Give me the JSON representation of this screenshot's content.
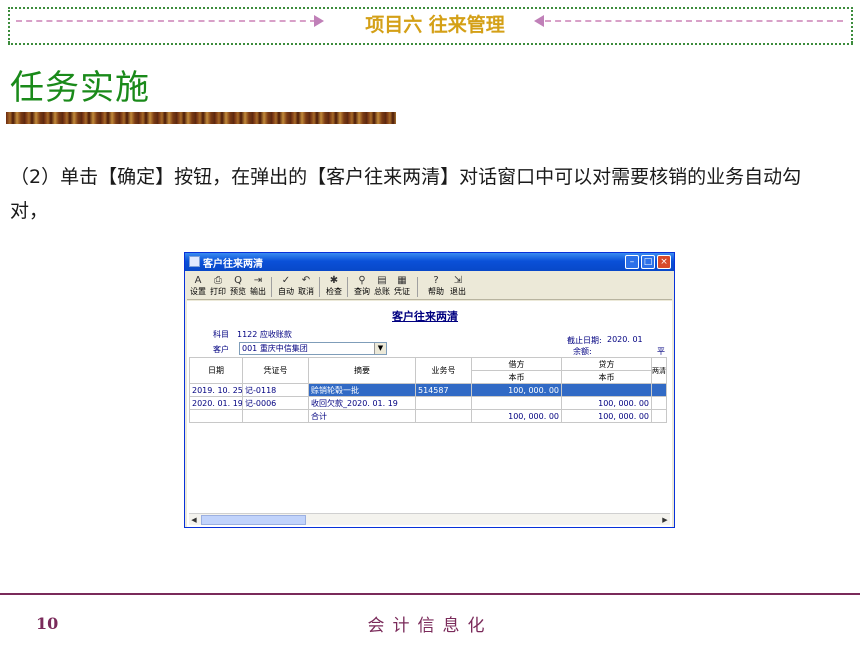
{
  "header": {
    "title": "项目六 往来管理"
  },
  "task_title": "任务实施",
  "paragraph": "（2）单击【确定】按钮，在弹出的【客户往来两清】对话窗口中可以对需要核销的业务自动勾对，",
  "window": {
    "title": "客户往来两清",
    "toolbar": [
      {
        "label": "设置",
        "icon": "settings-icon",
        "glyph": "A"
      },
      {
        "label": "打印",
        "icon": "print-icon",
        "glyph": "⎙"
      },
      {
        "label": "预览",
        "icon": "preview-icon",
        "glyph": "Q"
      },
      {
        "label": "输出",
        "icon": "export-icon",
        "glyph": "⇥"
      },
      {
        "label": "自动",
        "icon": "auto-icon",
        "glyph": "✓"
      },
      {
        "label": "取消",
        "icon": "undo-icon",
        "glyph": "↶"
      },
      {
        "label": "检查",
        "icon": "check-icon",
        "glyph": "✱"
      },
      {
        "label": "查询",
        "icon": "binoculars-icon",
        "glyph": "⚲"
      },
      {
        "label": "总账",
        "icon": "ledger-icon",
        "glyph": "▤"
      },
      {
        "label": "凭证",
        "icon": "voucher-icon",
        "glyph": "▦"
      },
      {
        "label": "帮助",
        "icon": "help-icon",
        "glyph": "?"
      },
      {
        "label": "退出",
        "icon": "exit-icon",
        "glyph": "⇲"
      }
    ],
    "doc_title": "客户往来两清",
    "subject_label": "科目",
    "subject_value": "1122 应收账款",
    "customer_label": "客户",
    "customer_value": "001  重庆中信集团",
    "cutoff_label": "截止日期:",
    "cutoff_value": "2020. 01",
    "balance_label": "余额:",
    "balance_value": "平",
    "columns": {
      "date": "日期",
      "voucher": "凭证号",
      "summary": "摘要",
      "biz_no": "业务号",
      "debit": "借方",
      "credit": "贷方",
      "debit_sub": "本币",
      "credit_sub": "本币",
      "clear": "两清"
    },
    "rows": [
      {
        "date": "2019. 10. 25",
        "voucher": "记-0118",
        "summary": "赊销轮毂一批",
        "biz_no": "514587",
        "debit": "100, 000. 00",
        "credit": "",
        "selected": true
      },
      {
        "date": "2020. 01. 19",
        "voucher": "记-0006",
        "summary": "收回欠款_2020. 01. 19",
        "biz_no": "",
        "debit": "",
        "credit": "100, 000. 00",
        "selected": false
      },
      {
        "date": "",
        "voucher": "",
        "summary": "合计",
        "biz_no": "",
        "debit": "100, 000. 00",
        "credit": "100, 000. 00",
        "selected": false
      }
    ]
  },
  "footer": {
    "page": "10",
    "text": "会计信息化"
  },
  "colors": {
    "header_gold": "#d4a017",
    "title_green": "#1a8a1a",
    "footer_purple": "#7a2a5a",
    "selection_blue": "#316ac5"
  }
}
